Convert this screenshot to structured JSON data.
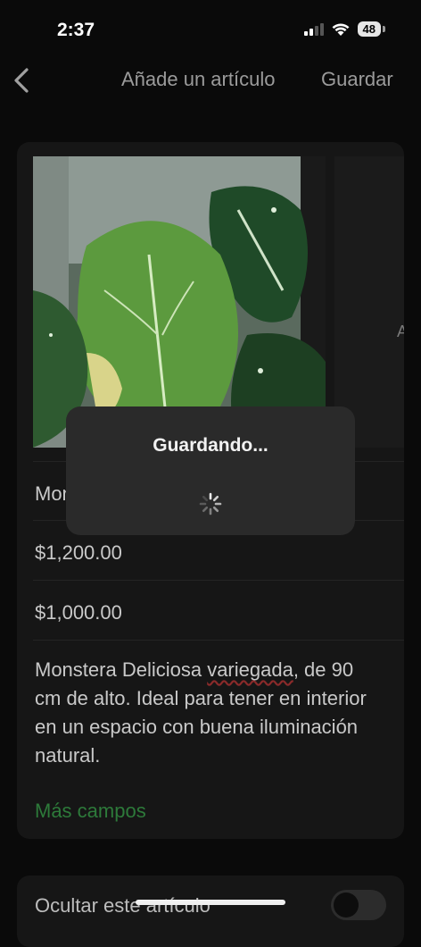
{
  "status_bar": {
    "time": "2:37",
    "battery": "48"
  },
  "nav": {
    "title": "Añade un artículo",
    "save_label": "Guardar"
  },
  "form": {
    "title_value": "Monstera",
    "price": "$1,200.00",
    "sale_price": "$1,000.00",
    "description_before": "Monstera Deliciosa ",
    "description_flagged": "variegada",
    "description_after": ", de 90 cm de alto. Ideal para tener en interior en un espacio con buena iluminación natural.",
    "more_fields": "Más campos",
    "second_photo_text": "A"
  },
  "visibility": {
    "hide_label": "Ocultar este artículo",
    "hidden": false
  },
  "saving_overlay": {
    "title": "Guardando..."
  },
  "colors": {
    "accent_green": "#2d7a3a",
    "background": "#0a0a0a",
    "card": "#161616"
  }
}
